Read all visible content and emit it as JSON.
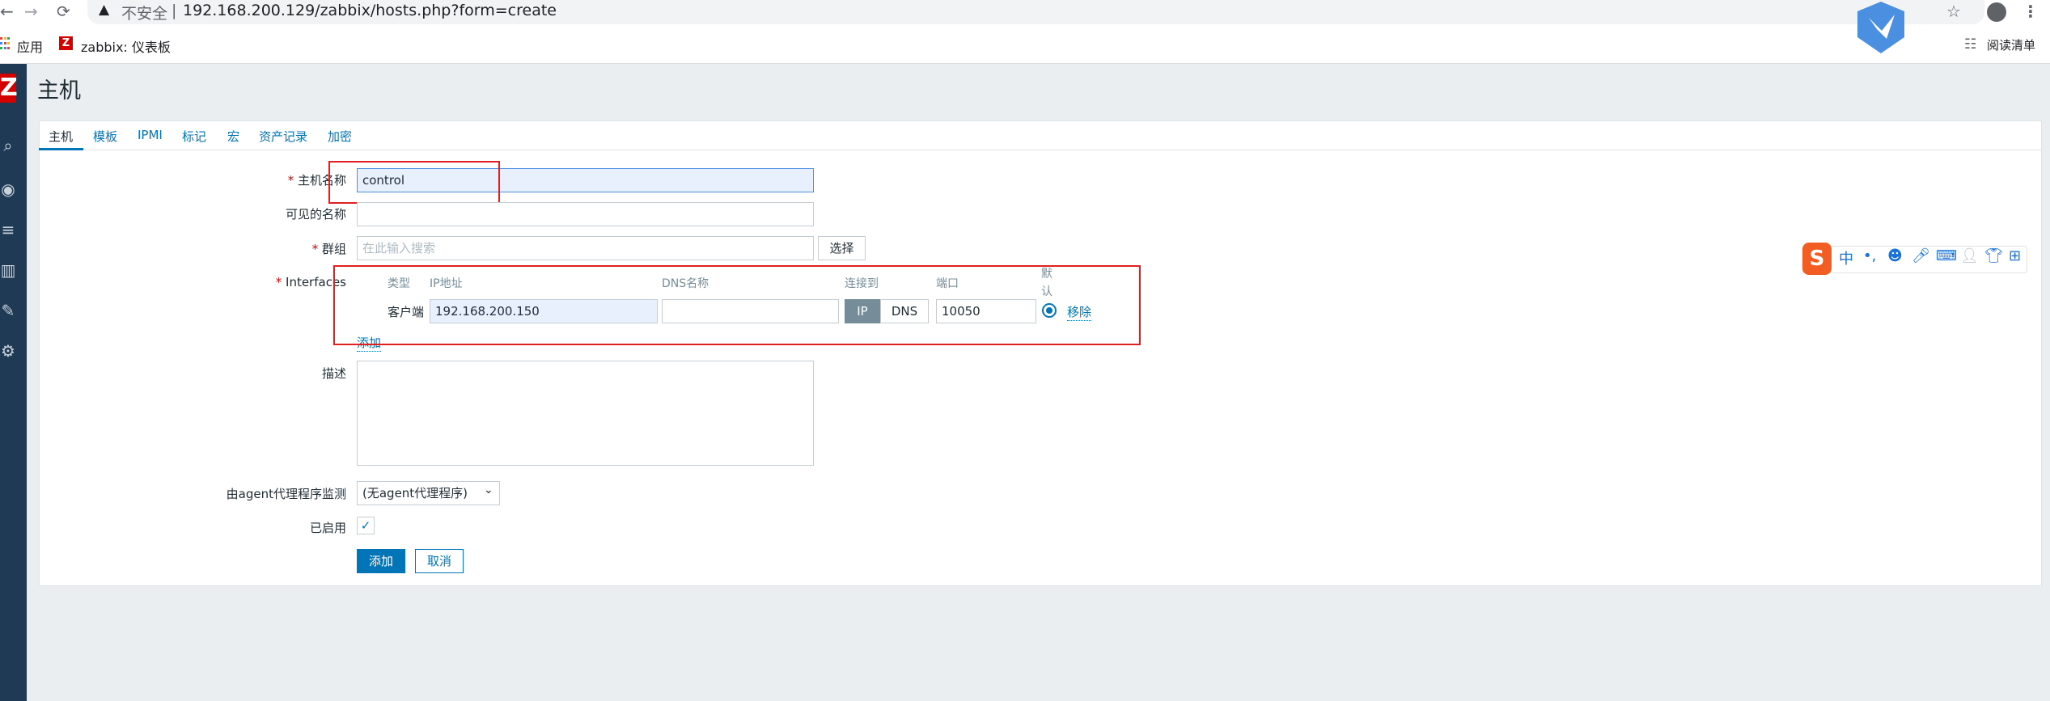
{
  "browser": {
    "security_label": "不安全",
    "url": "192.168.200.129/zabbix/hosts.php?form=create",
    "bookmarks": [
      {
        "label": "应用"
      },
      {
        "label": "zabbix: 仪表板"
      }
    ],
    "reading_list": "阅读清单"
  },
  "logo_letter": "Z",
  "page": {
    "title": "主机",
    "tabs": [
      "主机",
      "模板",
      "IPMI",
      "标记",
      "宏",
      "资产记录",
      "加密"
    ]
  },
  "form": {
    "host_name": {
      "label": "主机名称",
      "value": "control"
    },
    "visible_name": {
      "label": "可见的名称",
      "value": ""
    },
    "groups": {
      "label": "群组",
      "placeholder": "在此输入搜索",
      "select_label": "选择"
    },
    "interfaces": {
      "label": "Interfaces",
      "headers": {
        "type": "类型",
        "ip": "IP地址",
        "dns": "DNS名称",
        "connect": "连接到",
        "port": "端口",
        "default": "默认"
      },
      "row": {
        "type": "客户端",
        "ip": "192.168.200.150",
        "dns": "",
        "connect_ip": "IP",
        "connect_dns": "DNS",
        "port": "10050",
        "remove": "移除"
      },
      "add": "添加"
    },
    "description": {
      "label": "描述",
      "value": ""
    },
    "proxy": {
      "label": "由agent代理程序监测",
      "value": "(无agent代理程序)"
    },
    "enabled": {
      "label": "已启用",
      "checked": true
    },
    "buttons": {
      "add": "添加",
      "cancel": "取消"
    }
  },
  "ime_toolbar": {
    "lang": "中"
  },
  "colors": {
    "accent": "#0275b8",
    "sidebar": "#1f3a55",
    "logo": "#d40000",
    "annotation": "#e02020"
  }
}
